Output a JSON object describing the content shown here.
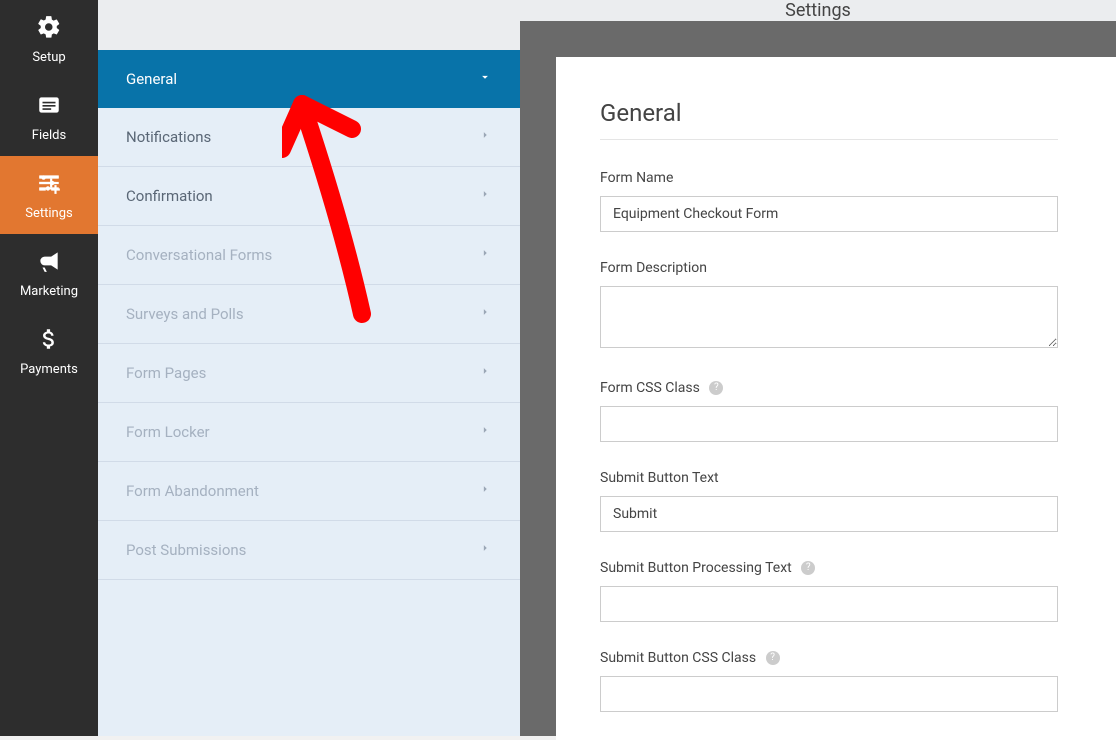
{
  "topbar": {
    "title": "Settings"
  },
  "nav": {
    "items": [
      {
        "label": "Setup"
      },
      {
        "label": "Fields"
      },
      {
        "label": "Settings"
      },
      {
        "label": "Marketing"
      },
      {
        "label": "Payments"
      }
    ]
  },
  "settings_menu": {
    "items": [
      {
        "label": "General"
      },
      {
        "label": "Notifications"
      },
      {
        "label": "Confirmation"
      },
      {
        "label": "Conversational Forms"
      },
      {
        "label": "Surveys and Polls"
      },
      {
        "label": "Form Pages"
      },
      {
        "label": "Form Locker"
      },
      {
        "label": "Form Abandonment"
      },
      {
        "label": "Post Submissions"
      }
    ]
  },
  "form": {
    "heading": "General",
    "fields": {
      "form_name": {
        "label": "Form Name",
        "value": "Equipment Checkout Form"
      },
      "form_description": {
        "label": "Form Description",
        "value": ""
      },
      "form_css_class": {
        "label": "Form CSS Class",
        "value": ""
      },
      "submit_button_text": {
        "label": "Submit Button Text",
        "value": "Submit"
      },
      "submit_button_processing_text": {
        "label": "Submit Button Processing Text",
        "value": ""
      },
      "submit_button_css_class": {
        "label": "Submit Button CSS Class",
        "value": ""
      }
    }
  }
}
